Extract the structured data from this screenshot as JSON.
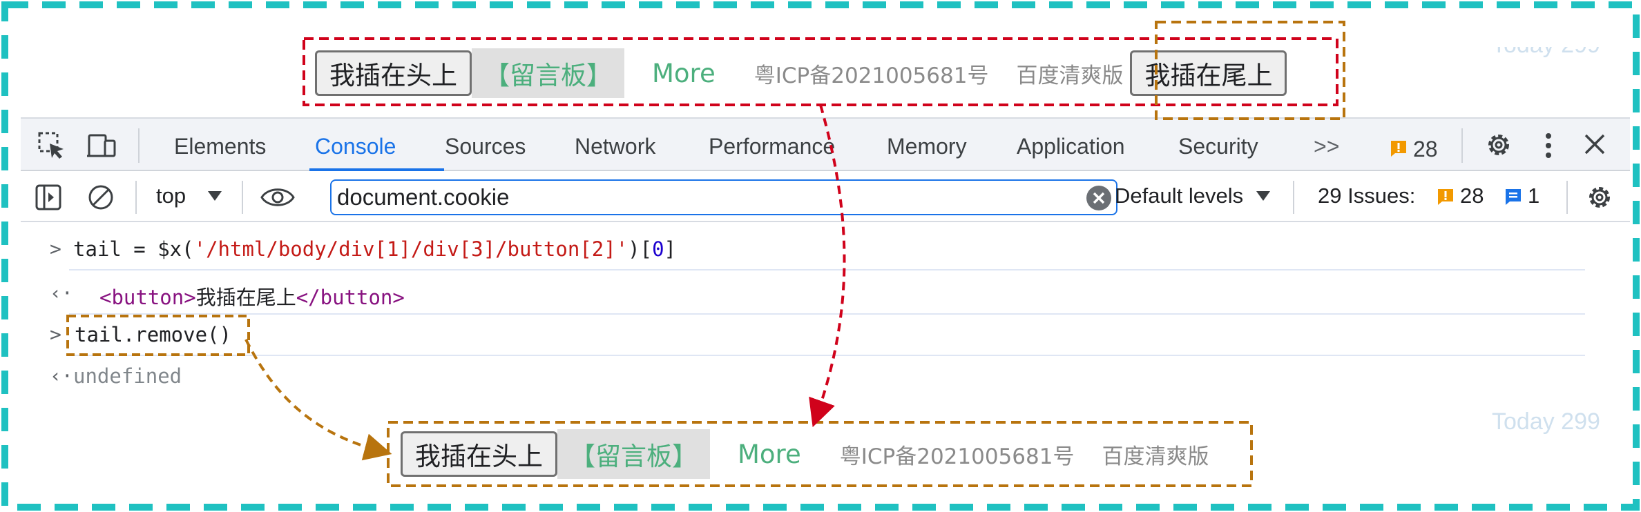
{
  "page_preview": {
    "head_button": "我插在头上",
    "board_label": "【留言板】",
    "more_link": "More",
    "icp": "粤ICP备2021005681号",
    "baidu": "百度清爽版",
    "tail_button": "我插在尾上",
    "today_top": "Today 299",
    "today_bottom": "Today 299"
  },
  "devtools": {
    "tabs": [
      "Elements",
      "Console",
      "Sources",
      "Network",
      "Performance",
      "Memory",
      "Application",
      "Security"
    ],
    "active_tab": "Console",
    "more_tabs": ">>",
    "issues_badge": "28",
    "icons": [
      "inspect-icon",
      "device-toolbar-icon",
      "gear-icon",
      "kebab-menu-icon",
      "close-icon"
    ]
  },
  "console_toolbar": {
    "context": "top",
    "filter_value": "document.cookie",
    "levels": "Default levels",
    "issues_label": "29 Issues:",
    "issues_warn": "28",
    "issues_info": "1"
  },
  "console": {
    "line1_prefix": "tail = $x(",
    "line1_str": "'/html/body/div[1]/div[3]/button[2]'",
    "line1_mid": ")[",
    "line1_num": "0",
    "line1_end": "]",
    "result1_open": "<button>",
    "result1_text": "我插在尾上",
    "result1_close": "</button>",
    "line2": "tail.remove()",
    "result2": "undefined"
  },
  "colors": {
    "frame": "#1fc1c1",
    "red_annotation": "#d0021b",
    "orange_annotation": "#b8740e",
    "accent": "#1a73e8",
    "link_green": "#4caf7d"
  }
}
